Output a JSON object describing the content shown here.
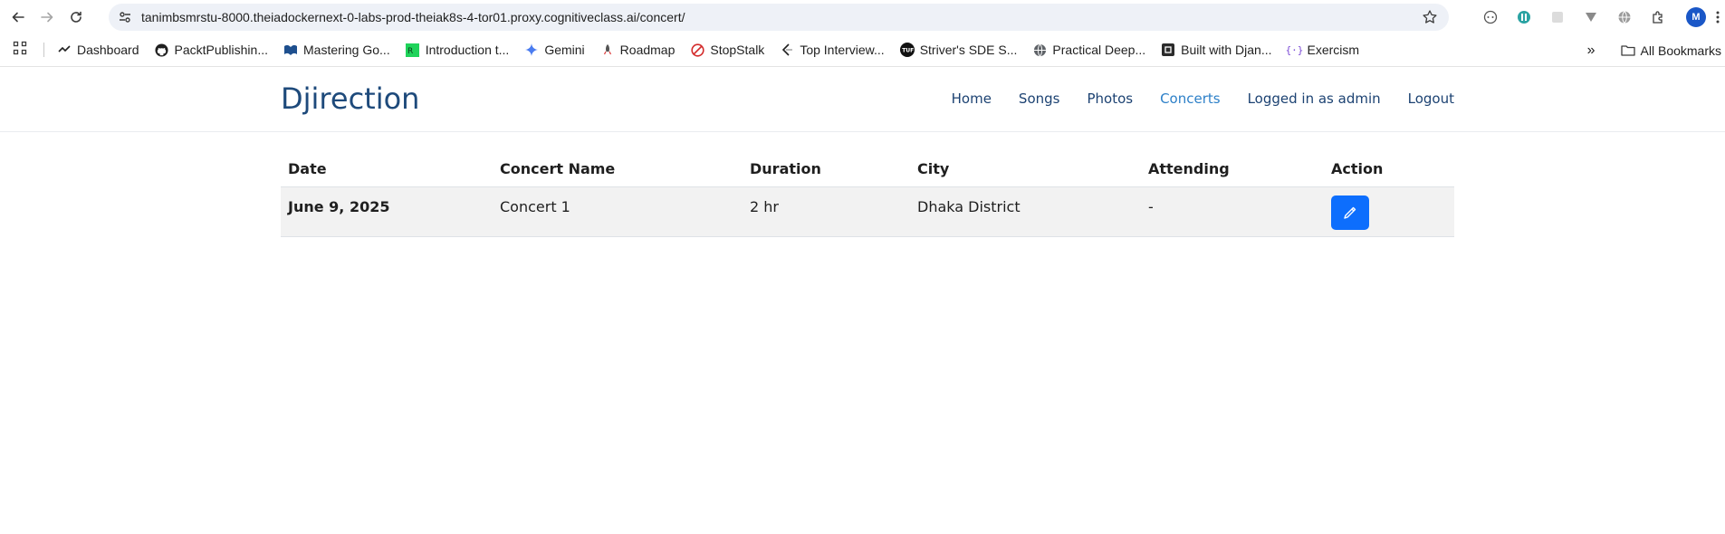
{
  "browser": {
    "url_host": "tanimbsmrstu-8000.theiadockernext-0-labs-prod-theiak8s-4-tor01.proxy.cognitiveclass.ai",
    "url_path": "/concert/",
    "avatar_letter": "M"
  },
  "bookmarks": {
    "items": [
      {
        "label": "Dashboard",
        "icon": "dashboard-icon"
      },
      {
        "label": "PacktPublishin...",
        "icon": "github-icon"
      },
      {
        "label": "Mastering Go...",
        "icon": "book-icon"
      },
      {
        "label": "Introduction t...",
        "icon": "rc-icon"
      },
      {
        "label": "Gemini",
        "icon": "gemini-icon"
      },
      {
        "label": "Roadmap",
        "icon": "rocket-icon"
      },
      {
        "label": "StopStalk",
        "icon": "stopstalk-icon"
      },
      {
        "label": "Top Interview...",
        "icon": "leetcode-icon"
      },
      {
        "label": "Striver's SDE S...",
        "icon": "tuf-icon"
      },
      {
        "label": "Practical Deep...",
        "icon": "globe-icon"
      },
      {
        "label": "Built with Djan...",
        "icon": "django-icon"
      },
      {
        "label": "Exercism",
        "icon": "exercism-icon"
      }
    ],
    "more_label": "»",
    "all_label": "All Bookmarks"
  },
  "site": {
    "brand": "Djirection",
    "menu": [
      {
        "label": "Home",
        "active": false
      },
      {
        "label": "Songs",
        "active": false
      },
      {
        "label": "Photos",
        "active": false
      },
      {
        "label": "Concerts",
        "active": true
      },
      {
        "label": "Logged in as admin",
        "active": false
      },
      {
        "label": "Logout",
        "active": false
      }
    ]
  },
  "concerts_table": {
    "headers": [
      "Date",
      "Concert Name",
      "Duration",
      "City",
      "Attending",
      "Action"
    ],
    "rows": [
      {
        "date": "June 9, 2025",
        "name": "Concert 1",
        "duration": "2 hr",
        "city": "Dhaka District",
        "attending": "-",
        "action_icon": "pencil-icon"
      }
    ]
  },
  "colors": {
    "brand": "#1e4a7b",
    "nav_link": "#1c4272",
    "nav_active": "#2d80c8",
    "edit_button": "#0d6efd",
    "row_bg": "#f2f2f2"
  }
}
